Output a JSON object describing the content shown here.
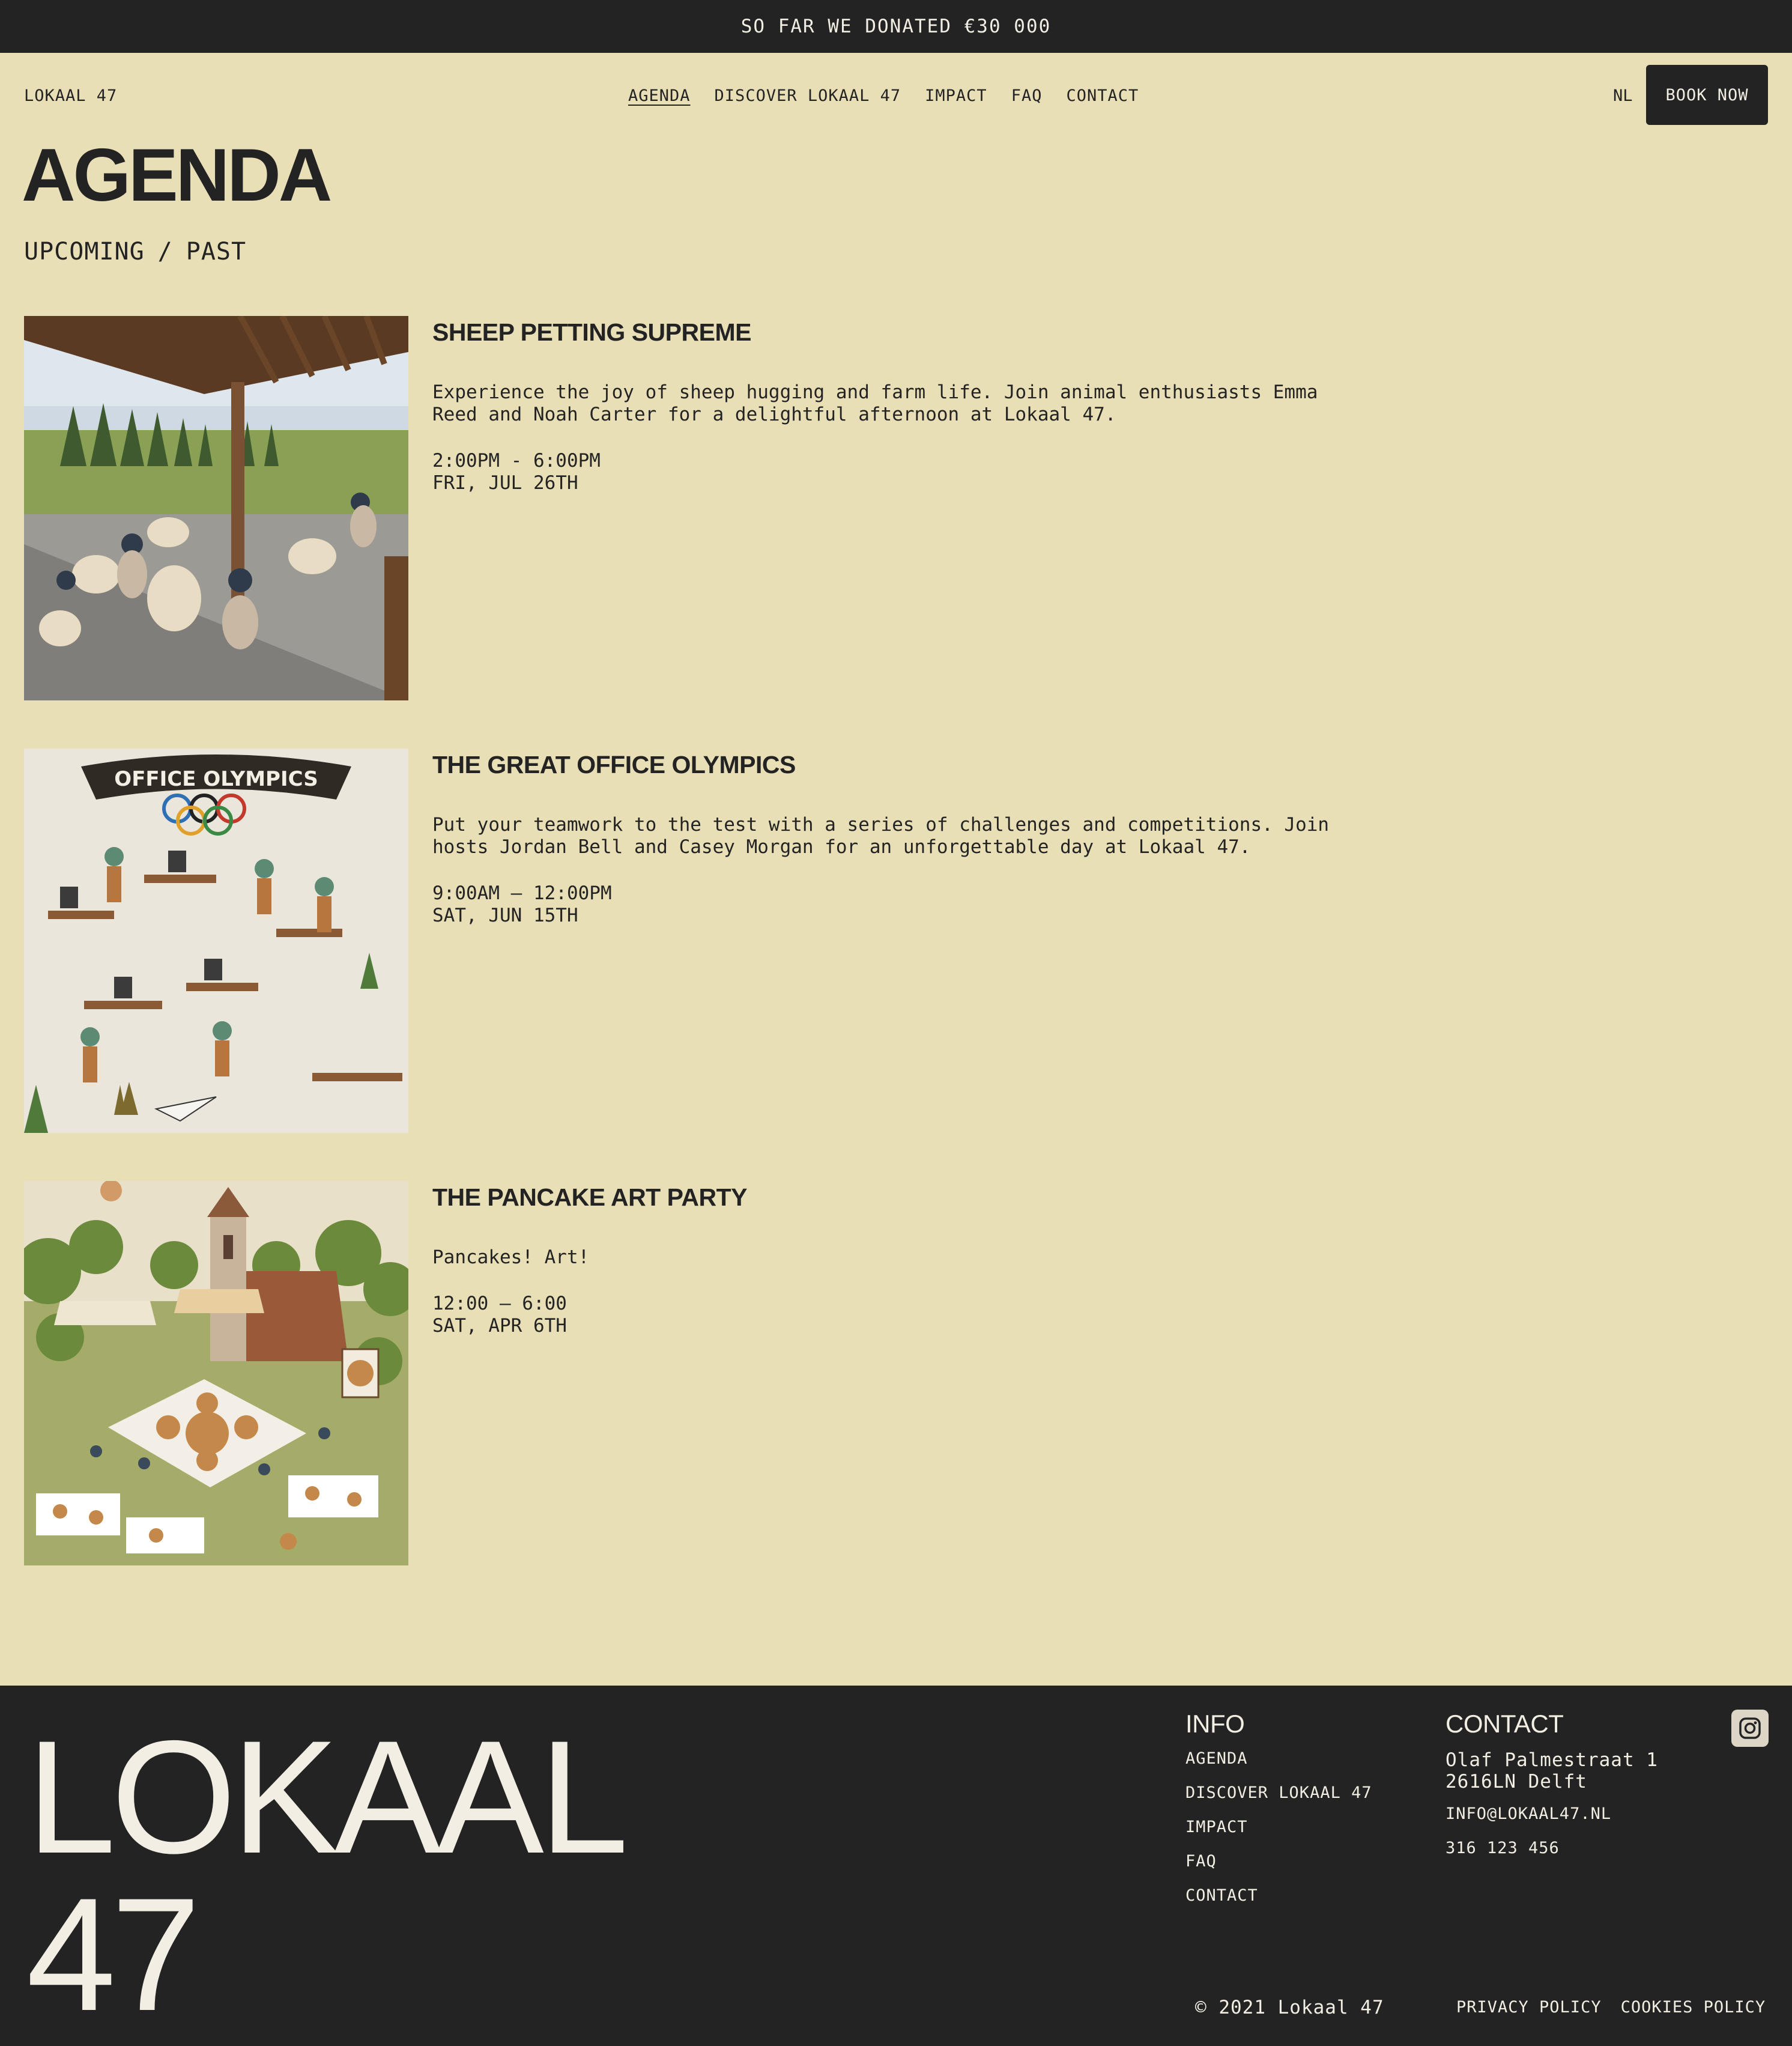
{
  "announcement": "SO FAR WE DONATED €30 000",
  "nav": {
    "brand": "LOKAAL 47",
    "items": [
      {
        "label": "AGENDA"
      },
      {
        "label": "DISCOVER LOKAAL 47"
      },
      {
        "label": "IMPACT"
      },
      {
        "label": "FAQ"
      },
      {
        "label": "CONTACT"
      }
    ],
    "lang": "NL",
    "book_label": "BOOK NOW"
  },
  "page": {
    "title": "AGENDA",
    "filter_upcoming": "UPCOMING",
    "filter_sep": "/",
    "filter_past": "PAST"
  },
  "events": [
    {
      "title": "SHEEP PETTING SUPREME",
      "description": "Experience the joy of sheep hugging and farm life. Join animal enthusiasts Emma\nReed and Noah Carter for a delightful afternoon at Lokaal 47.",
      "time": "2:00PM - 6:00PM",
      "date": "FRI, JUL 26TH"
    },
    {
      "title": "THE GREAT OFFICE OLYMPICS",
      "image_banner": "OFFICE OLYMPICS",
      "description": "Put your teamwork to the test with a series of challenges and competitions. Join\nhosts Jordan Bell and Casey Morgan for an unforgettable day at Lokaal 47.",
      "time": "9:00AM — 12:00PM",
      "date": "SAT, JUN 15TH"
    },
    {
      "title": "THE PANCAKE ART PARTY",
      "description": "Pancakes! Art!",
      "time": "12:00 — 6:00",
      "date": "SAT, APR 6TH"
    }
  ],
  "footer": {
    "big_line1": "LOKAAL",
    "big_line2": "47",
    "info_heading": "INFO",
    "info_links": [
      {
        "label": "AGENDA"
      },
      {
        "label": "DISCOVER LOKAAL 47"
      },
      {
        "label": "IMPACT"
      },
      {
        "label": "FAQ"
      },
      {
        "label": "CONTACT"
      }
    ],
    "contact_heading": "CONTACT",
    "address_line1": "Olaf Palmestraat 1",
    "address_line2": "2616LN Delft",
    "email": "INFO@LOKAAL47.NL",
    "phone": "316 123 456",
    "copyright": "© 2021 Lokaal 47",
    "privacy": "PRIVACY POLICY",
    "cookies": "COOKIES POLICY",
    "social_icon": "instagram-icon"
  },
  "colors": {
    "background": "#e9dfb6",
    "dark": "#232323",
    "light_text": "#f2eee3"
  }
}
